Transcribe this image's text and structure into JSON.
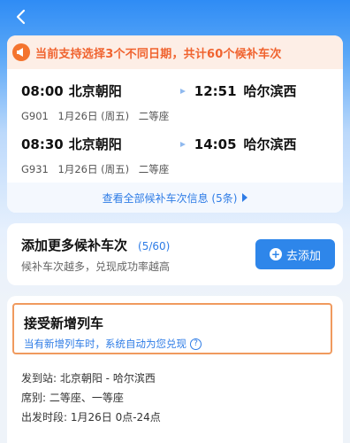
{
  "notice": {
    "text": "当前支持选择3个不同日期，共计60个候补车次"
  },
  "trains": [
    {
      "depart_time": "08:00",
      "depart_station": "北京朝阳",
      "arrive_time": "12:51",
      "arrive_station": "哈尔滨西",
      "train_no": "G901",
      "date": "1月26日 (周五)",
      "seat": "二等座"
    },
    {
      "depart_time": "08:30",
      "depart_station": "北京朝阳",
      "arrive_time": "14:05",
      "arrive_station": "哈尔滨西",
      "train_no": "G931",
      "date": "1月26日 (周五)",
      "seat": "二等座"
    }
  ],
  "see_all": {
    "label": "查看全部候补车次信息 (5条)"
  },
  "add_more": {
    "title": "添加更多候补车次",
    "count": "(5/60)",
    "subtitle": "候补车次越多，兑现成功率越高",
    "button": "去添加"
  },
  "accept_new": {
    "title": "接受新增列车",
    "subtitle": "当有新增列车时，系统自动为您兑现"
  },
  "info": {
    "station": "发到站:  北京朝阳 - 哈尔滨西",
    "seats": "席别:   二等座、一等座",
    "period": "出发时段:  1月26日 0点-24点"
  },
  "colors": {
    "primary": "#2e86ea",
    "warning": "#f0632f",
    "highlight_border": "#f09a5e"
  },
  "icons": {
    "back": "chevron-left-icon",
    "notice": "megaphone-icon",
    "arrow": "arrow-right-icon",
    "add": "plus-circle-icon",
    "help": "question-circle-icon"
  }
}
